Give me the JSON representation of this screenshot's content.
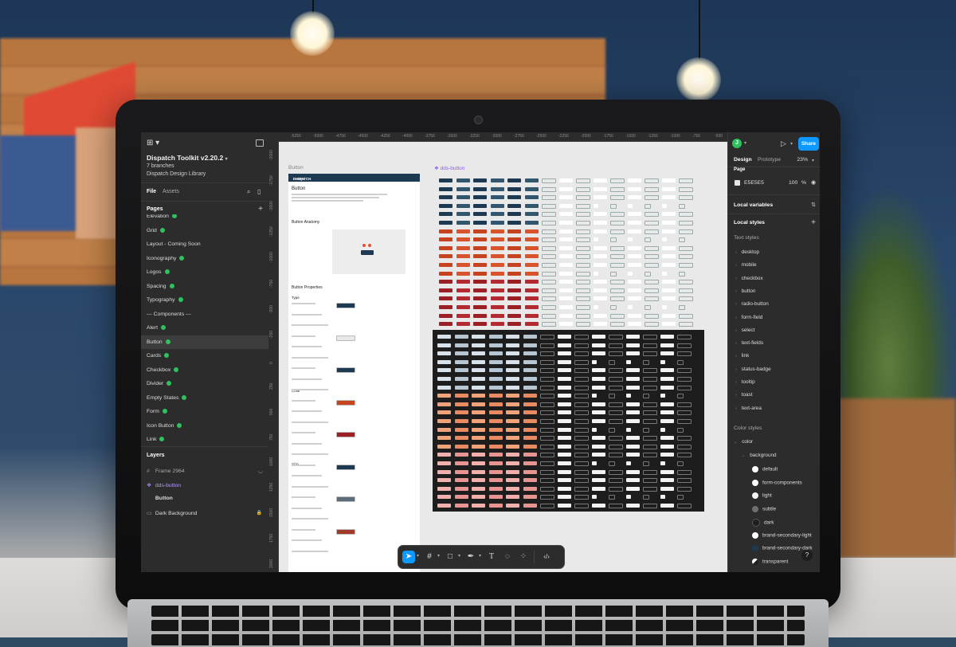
{
  "app": {
    "file_name": "Dispatch Toolkit v2.20.2",
    "branches": "7 branches",
    "library": "Dispatch Design Library",
    "logo_icon": "figma-logo-icon"
  },
  "left_panel": {
    "tabs": [
      "File",
      "Assets"
    ],
    "pages_label": "Pages",
    "pages": [
      {
        "label": "Elevation",
        "dot": true
      },
      {
        "label": "Grid",
        "dot": true
      },
      {
        "label": "Layout - Coming Soon",
        "dot": false
      },
      {
        "label": "Iconography",
        "dot": true
      },
      {
        "label": "Logos",
        "dot": true
      },
      {
        "label": "Spacing",
        "dot": true
      },
      {
        "label": "Typography",
        "dot": true
      },
      {
        "label": "--- Components ---",
        "dot": false
      },
      {
        "label": "Alert",
        "dot": true
      },
      {
        "label": "Button",
        "dot": true,
        "selected": true
      },
      {
        "label": "Cards",
        "dot": true
      },
      {
        "label": "Checkbox",
        "dot": true
      },
      {
        "label": "Divider",
        "dot": true
      },
      {
        "label": "Empty States",
        "dot": true
      },
      {
        "label": "Form",
        "dot": true
      },
      {
        "label": "Icon Button",
        "dot": true
      },
      {
        "label": "Link",
        "dot": true
      }
    ],
    "layers_label": "Layers",
    "layers": [
      {
        "label": "Frame 2964",
        "icon": "frame-icon"
      },
      {
        "label": "dds-button",
        "icon": "component-icon"
      },
      {
        "label": "Button",
        "icon": "frame-icon"
      },
      {
        "label": "Dark Background",
        "icon": "rectangle-icon"
      }
    ]
  },
  "canvas": {
    "ruler_x": [
      "-5250",
      "-5000",
      "-4750",
      "-4500",
      "-4250",
      "-4000",
      "-3750",
      "-3500",
      "-3250",
      "-3000",
      "-2750",
      "-2500",
      "-2250",
      "-2000",
      "-1750",
      "-1500",
      "-1250",
      "-1000",
      "-750",
      "-500"
    ],
    "ruler_y": [
      "-2000",
      "-1750",
      "-1500",
      "-1250",
      "-1000",
      "-750",
      "-500",
      "-250",
      "0",
      "250",
      "500",
      "750",
      "1000",
      "1250",
      "1500",
      "1750",
      "2000"
    ],
    "frame_button_label": "Button",
    "frame_component_label": "dds-button",
    "doc": {
      "brand": "DISPATCH",
      "brand_sub": "Design System",
      "heading": "Button",
      "section_anatomy": "Button Anatomy",
      "section_properties": "Button Properties",
      "sub_type": "Type",
      "sub_color": "Color",
      "sub_size": "Size"
    }
  },
  "toolbar": {
    "tools": [
      "move-icon",
      "frame-icon",
      "shape-icon",
      "pen-icon",
      "text-icon",
      "comment-icon",
      "components-icon",
      "dev-mode-icon"
    ]
  },
  "right_panel": {
    "avatar_letter": "J",
    "share_label": "Share",
    "tabs": [
      "Design",
      "Prototype"
    ],
    "zoom": "23%",
    "page_label": "Page",
    "page_color": "E5E5E5",
    "page_opacity": "100",
    "percent_sign": "%",
    "local_variables": "Local variables",
    "local_styles": "Local styles",
    "text_styles_label": "Text styles",
    "text_styles": [
      "desktop",
      "mobile",
      "checkbox",
      "button",
      "radio-button",
      "form-field",
      "select",
      "text-fields",
      "link",
      "status-badge",
      "tooltip",
      "toast",
      "text-area"
    ],
    "color_styles_label": "Color styles",
    "color_group": "color",
    "color_subgroup": "background",
    "colors": [
      {
        "name": "default",
        "hex": "#ffffff"
      },
      {
        "name": "form-components",
        "hex": "#ffffff"
      },
      {
        "name": "light",
        "hex": "#f5f5f5"
      },
      {
        "name": "subtle",
        "hex": "#6f6f6f"
      },
      {
        "name": "dark",
        "hex": "#1e1e1e"
      },
      {
        "name": "brand-secondary-light",
        "hex": "#ffffff"
      },
      {
        "name": "brand-secondary-dark",
        "hex": "#1d3a52"
      },
      {
        "name": "transparent",
        "hex": "#ffffff"
      }
    ],
    "help": "?"
  }
}
